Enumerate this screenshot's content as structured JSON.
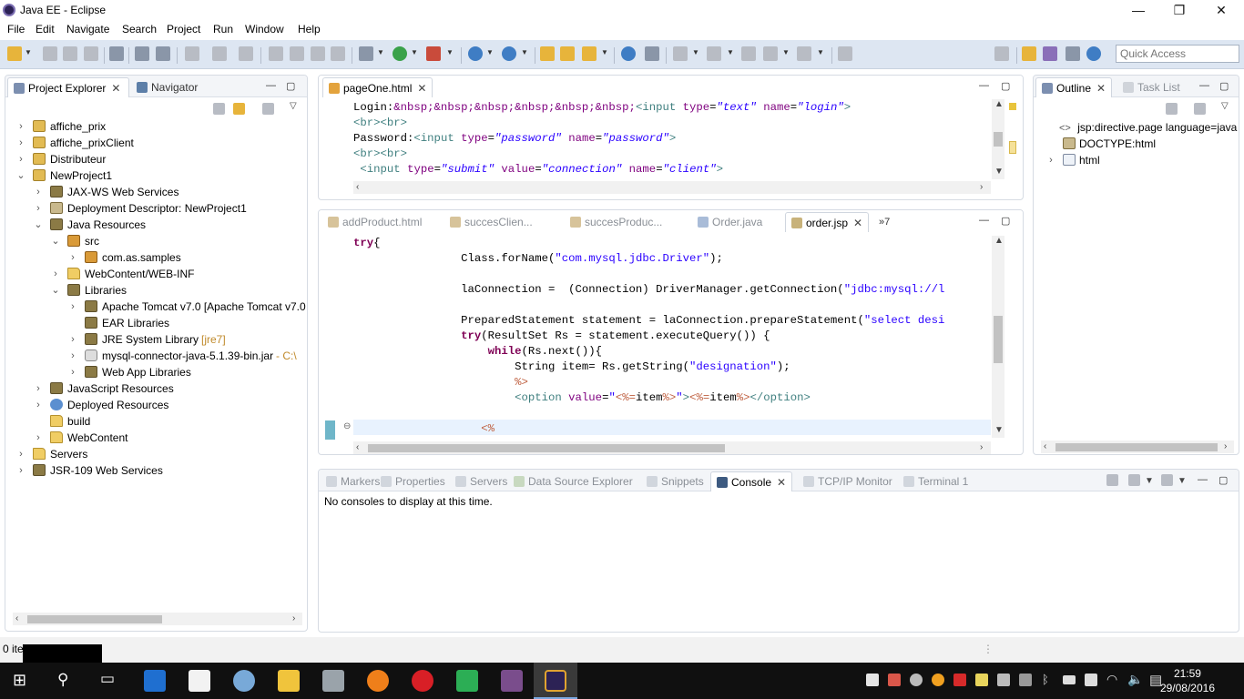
{
  "window": {
    "title": "Java EE - Eclipse",
    "minimize": "—",
    "restore": "❐",
    "close": "✕"
  },
  "menu": [
    "File",
    "Edit",
    "Navigate",
    "Search",
    "Project",
    "Run",
    "Window",
    "Help"
  ],
  "toolbar": {
    "quick_access_placeholder": "Quick Access"
  },
  "left_panel": {
    "tabs": [
      {
        "label": "Project Explorer",
        "close": "✕",
        "active": true
      },
      {
        "label": "Navigator",
        "active": false
      }
    ],
    "tree": [
      {
        "label": "affiche_prix",
        "indent": 0,
        "twisty": "›",
        "icon": "project"
      },
      {
        "label": "affiche_prixClient",
        "indent": 0,
        "twisty": "›",
        "icon": "project"
      },
      {
        "label": "Distributeur",
        "indent": 0,
        "twisty": "›",
        "icon": "project"
      },
      {
        "label": "NewProject1",
        "indent": 0,
        "twisty": "⌄",
        "icon": "project"
      },
      {
        "label": "JAX-WS Web Services",
        "indent": 1,
        "twisty": "›",
        "icon": "book"
      },
      {
        "label": "Deployment Descriptor: NewProject1",
        "indent": 1,
        "twisty": "›",
        "icon": "doc"
      },
      {
        "label": "Java Resources",
        "indent": 1,
        "twisty": "⌄",
        "icon": "book"
      },
      {
        "label": "src",
        "indent": 2,
        "twisty": "⌄",
        "icon": "pkg"
      },
      {
        "label": "com.as.samples",
        "indent": 3,
        "twisty": "›",
        "icon": "pkg"
      },
      {
        "label": "WebContent/WEB-INF",
        "indent": 2,
        "twisty": "›",
        "icon": "folder"
      },
      {
        "label": "Libraries",
        "indent": 2,
        "twisty": "⌄",
        "icon": "book"
      },
      {
        "label": "Apache Tomcat v7.0 [Apache Tomcat v7.0",
        "indent": 3,
        "twisty": "›",
        "icon": "book"
      },
      {
        "label": "EAR Libraries",
        "indent": 3,
        "twisty": "",
        "icon": "book"
      },
      {
        "label": "JRE System Library",
        "decor": "[jre7]",
        "indent": 3,
        "twisty": "›",
        "icon": "book"
      },
      {
        "label": "mysql-connector-java-5.1.39-bin.jar",
        "decor": " - C:\\",
        "indent": 3,
        "twisty": "›",
        "icon": "jar"
      },
      {
        "label": "Web App Libraries",
        "indent": 3,
        "twisty": "›",
        "icon": "book"
      },
      {
        "label": "JavaScript Resources",
        "indent": 1,
        "twisty": "›",
        "icon": "book"
      },
      {
        "label": "Deployed Resources",
        "indent": 1,
        "twisty": "›",
        "icon": "globe"
      },
      {
        "label": "build",
        "indent": 1,
        "twisty": "",
        "icon": "folder"
      },
      {
        "label": "WebContent",
        "indent": 1,
        "twisty": "›",
        "icon": "folder"
      },
      {
        "label": "Servers",
        "indent": 0,
        "twisty": "›",
        "icon": "folder"
      },
      {
        "label": "JSR-109 Web Services",
        "indent": 0,
        "twisty": "›",
        "icon": "book"
      }
    ]
  },
  "editor_top": {
    "tab": "pageOne.html",
    "close": "✕"
  },
  "editor_bottom": {
    "tabs": [
      "addProduct.html",
      "succesClien...",
      "succesProduc...",
      "Order.java",
      "order.jsp"
    ],
    "active_tab": "order.jsp",
    "close": "✕",
    "overflow": "»7"
  },
  "outline_panel": {
    "tabs": [
      {
        "label": "Outline",
        "close": "✕",
        "active": true
      },
      {
        "label": "Task List",
        "active": false
      }
    ],
    "items": [
      {
        "label": "jsp:directive.page language=java",
        "twisty": "",
        "icon": "<>"
      },
      {
        "label": "DOCTYPE:html",
        "twisty": "",
        "icon": "doc"
      },
      {
        "label": "html",
        "twisty": "›",
        "icon": "tag"
      }
    ]
  },
  "bottom_panel": {
    "tabs": [
      "Markers",
      "Properties",
      "Servers",
      "Data Source Explorer",
      "Snippets",
      "Console",
      "TCP/IP Monitor",
      "Terminal 1"
    ],
    "active_tab": "Console",
    "close": "✕",
    "message": "No consoles to display at this time."
  },
  "status_bar": {
    "text": "0 items selected"
  },
  "taskbar": {
    "time": "21:59",
    "date": "29/08/2016"
  }
}
